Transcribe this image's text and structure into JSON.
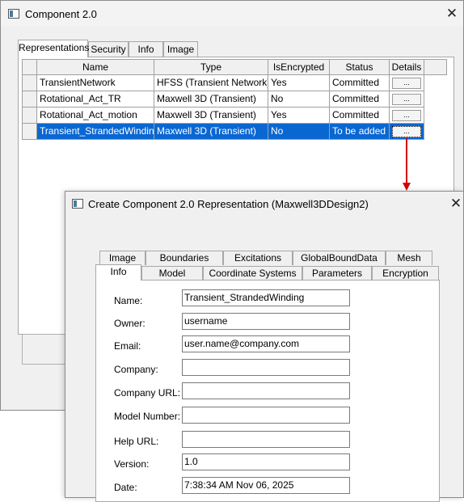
{
  "window1": {
    "title": "Component 2.0",
    "tabs": [
      {
        "label": "Representations"
      },
      {
        "label": "Security"
      },
      {
        "label": "Info"
      },
      {
        "label": "Image"
      }
    ],
    "grid": {
      "columns": [
        "Name",
        "Type",
        "IsEncrypted",
        "Status",
        "Details"
      ],
      "rows": [
        {
          "name": "TransientNetwork",
          "type": "HFSS (Transient Network)",
          "encrypted": "Yes",
          "status": "Committed",
          "details": "..."
        },
        {
          "name": "Rotational_Act_TR",
          "type": "Maxwell 3D (Transient)",
          "encrypted": "No",
          "status": "Committed",
          "details": "..."
        },
        {
          "name": "Rotational_Act_motion",
          "type": "Maxwell 3D (Transient)",
          "encrypted": "Yes",
          "status": "Committed",
          "details": "..."
        },
        {
          "name": "Transient_StrandedWinding",
          "type": "Maxwell 3D (Transient)",
          "encrypted": "No",
          "status": "To be added",
          "details": "..."
        }
      ],
      "selected_row_index": 3
    }
  },
  "window2": {
    "title": "Create Component 2.0 Representation (Maxwell3DDesign2)",
    "tabs_row1": [
      {
        "label": "Image"
      },
      {
        "label": "Boundaries"
      },
      {
        "label": "Excitations"
      },
      {
        "label": "GlobalBoundData"
      },
      {
        "label": "Mesh"
      }
    ],
    "tabs_row2": [
      {
        "label": "Info"
      },
      {
        "label": "Model"
      },
      {
        "label": "Coordinate Systems"
      },
      {
        "label": "Parameters"
      },
      {
        "label": "Encryption"
      }
    ],
    "form": {
      "name": {
        "label": "Name:",
        "value": "Transient_StrandedWinding"
      },
      "owner": {
        "label": "Owner:",
        "value": "username"
      },
      "email": {
        "label": "Email:",
        "value": "user.name@company.com"
      },
      "company": {
        "label": "Company:",
        "value": ""
      },
      "company_url": {
        "label": "Company URL:",
        "value": ""
      },
      "model_number": {
        "label": "Model Number:",
        "value": ""
      },
      "help_url": {
        "label": "Help URL:",
        "value": ""
      },
      "version": {
        "label": "Version:",
        "value": "1.0"
      },
      "date": {
        "label": "Date:",
        "value": "7:38:34 AM  Nov 06, 2025"
      }
    }
  },
  "annotation": {
    "arrow_color": "#d40000"
  },
  "colors": {
    "selection": "#0a67d2",
    "window_bg": "#f0f0f0"
  },
  "icons": {
    "app": "window-app-icon",
    "close": "close-icon",
    "arrow": "annotation-arrow"
  }
}
